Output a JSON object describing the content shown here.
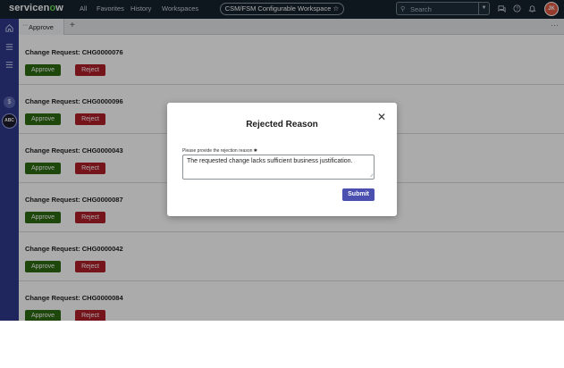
{
  "topnav": {
    "logo_pre": "servicen",
    "logo_o": "o",
    "logo_post": "w",
    "menu": [
      "All",
      "Favorites",
      "History",
      "Workspaces"
    ],
    "workspace_label": "CSM/FSM Configurable Workspace",
    "workspace_star": "☆",
    "search_placeholder": "Search",
    "avatar_initials": "JK"
  },
  "tabs": [
    {
      "label": "Approve"
    }
  ],
  "tab_add": "+",
  "tab_more": "···",
  "cards": [
    {
      "title": "Change Request: CHG0000076",
      "approve": "Approve",
      "reject": "Reject"
    },
    {
      "title": "Change Request: CHG0000096",
      "approve": "Approve",
      "reject": "Reject"
    },
    {
      "title": "Change Request: CHG0000043",
      "approve": "Approve",
      "reject": "Reject"
    },
    {
      "title": "Change Request: CHG0000087",
      "approve": "Approve",
      "reject": "Reject"
    },
    {
      "title": "Change Request: CHG0000042",
      "approve": "Approve",
      "reject": "Reject"
    },
    {
      "title": "Change Request: CHG0000084",
      "approve": "Approve",
      "reject": "Reject"
    }
  ],
  "rail": {
    "abc_label": "ABC"
  },
  "modal": {
    "title": "Rejected Reason",
    "close": "✕",
    "field_label": "Please provide the rejection reason",
    "required_mark": "✱",
    "field_value": "The requested change lacks sufficient business justification.",
    "submit": "Submit"
  },
  "colors": {
    "approve": "#2e6a12",
    "reject": "#b01e2a",
    "submit": "#4a4fb0",
    "rail": "#2f3a8c",
    "topnav": "#16232e"
  }
}
